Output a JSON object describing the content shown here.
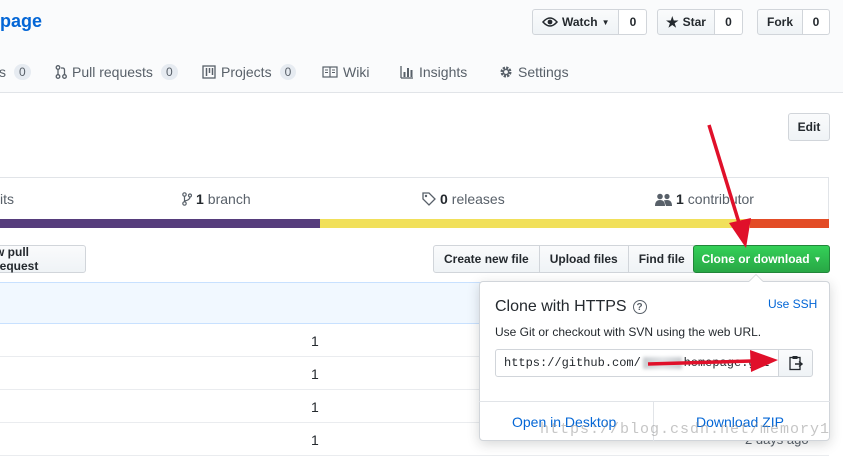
{
  "header": {
    "repo_name_fragment": "page",
    "watch": {
      "label": "Watch",
      "count": "0"
    },
    "star": {
      "label": "Star",
      "count": "0"
    },
    "fork": {
      "label": "Fork",
      "count": "0"
    }
  },
  "tabs": [
    {
      "label": "s",
      "badge": "0"
    },
    {
      "label": "Pull requests",
      "badge": "0"
    },
    {
      "label": "Projects",
      "badge": "0"
    },
    {
      "label": "Wiki"
    },
    {
      "label": "Insights"
    },
    {
      "label": "Settings"
    }
  ],
  "edit_label": "Edit",
  "summary": {
    "commits_fragment": "its",
    "branch_count": "1",
    "branch_label": "branch",
    "releases_count": "0",
    "releases_label": "releases",
    "contributors_count": "1",
    "contributors_label": "contributor"
  },
  "language_colors": [
    "#563d7c",
    "#f1e05a",
    "#e34c26"
  ],
  "actions": {
    "pull_request_fragment": "w pull request",
    "create_file": "Create new file",
    "upload_files": "Upload files",
    "find_file": "Find file",
    "clone_download": "Clone or download"
  },
  "file_rows": [
    {
      "msg": "1"
    },
    {
      "msg": "1"
    },
    {
      "msg": "1"
    },
    {
      "msg": "1"
    }
  ],
  "clone_panel": {
    "title": "Clone with HTTPS",
    "help_glyph": "?",
    "use_ssh": "Use SSH",
    "description": "Use Git or checkout with SVN using the web URL.",
    "url": "https://github.com/",
    "url_tail": "homepage.git",
    "open_desktop": "Open in Desktop",
    "download_zip": "Download ZIP"
  },
  "time_ago": "2 days ago",
  "watermark": "https://blog.csdn.net/memory1",
  "colors": {
    "accent": "#0366d6",
    "green": "#28a745",
    "arrow": "#e0102a"
  }
}
